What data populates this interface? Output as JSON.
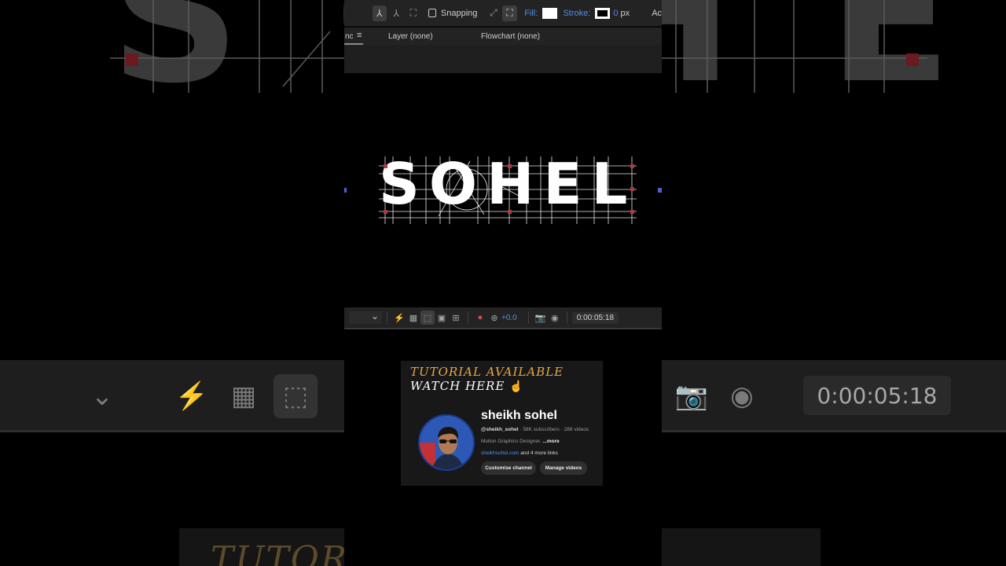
{
  "background": {
    "big_text": "SOHEL",
    "timecode": "0:00:05:18",
    "tutorial_text": "TUTORIAL AVAILABLE"
  },
  "toolbar": {
    "snapping_label": "Snapping",
    "fill_label": "Fill:",
    "stroke_label": "Stroke:",
    "stroke_value": "0",
    "stroke_unit": "px",
    "overflow_label": "Ac"
  },
  "panel": {
    "left_tab_partial": "nc",
    "menu_icon": "≡",
    "layer_tab": "Layer (none)",
    "flowchart_tab": "Flowchart (none)"
  },
  "viewer": {
    "logo_text": "SOHEL"
  },
  "viewer_bar": {
    "exposure_value": "+0.0",
    "timecode": "0:00:05:18"
  },
  "card": {
    "tutorial_line1": "TUTORIAL AVAILABLE",
    "tutorial_line2": "WATCH HERE",
    "hand_icon": "☝",
    "channel_name": "sheikh sohel",
    "handle": "@sheikh_sohel",
    "stats": "· 58K subscribers · 288 videos",
    "description": "Motion Graphics Designer.",
    "more": "...more",
    "link": "sheikhsohel.com",
    "more_links": "and 4 more links",
    "customise_button": "Customise channel",
    "manage_button": "Manage videos"
  },
  "colors": {
    "accent_blue": "#4e8de8",
    "tutorial_gold": "#e8a845",
    "anchor_red": "#b1363f"
  }
}
